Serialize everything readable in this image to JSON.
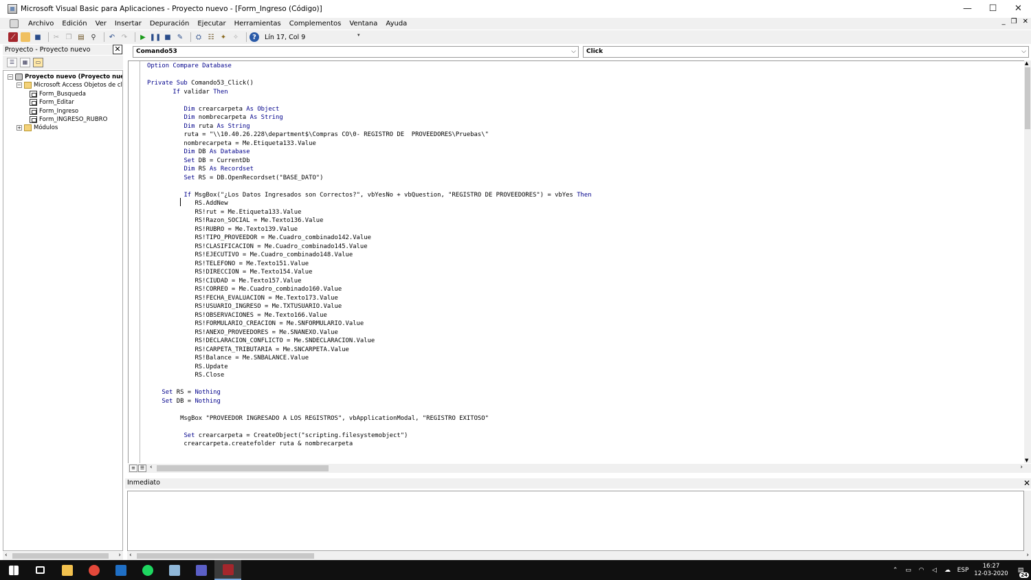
{
  "window": {
    "title": "Microsoft Visual Basic para Aplicaciones - Proyecto nuevo - [Form_Ingreso (Código)]",
    "minimize": "—",
    "maximize": "☐",
    "close": "✕"
  },
  "menubar": {
    "items": [
      "Archivo",
      "Edición",
      "Ver",
      "Insertar",
      "Depuración",
      "Ejecutar",
      "Herramientas",
      "Complementos",
      "Ventana",
      "Ayuda"
    ],
    "mdi_min": "_",
    "mdi_restore": "❐",
    "mdi_close": "✕"
  },
  "toolbar": {
    "position": "Lín 17, Col 9"
  },
  "project": {
    "title": "Proyecto - Proyecto nuevo",
    "close": "✕",
    "tree": [
      {
        "label": "Proyecto nuevo (Proyecto nuev",
        "level": 0,
        "icon": "proj",
        "expander": "−",
        "bold": true
      },
      {
        "label": "Microsoft Access Objetos de clas",
        "level": 1,
        "icon": "folder",
        "expander": "−",
        "bold": false
      },
      {
        "label": "Form_Busqueda",
        "level": 2,
        "icon": "form",
        "expander": "",
        "bold": false
      },
      {
        "label": "Form_Editar",
        "level": 2,
        "icon": "form",
        "expander": "",
        "bold": false
      },
      {
        "label": "Form_Ingreso",
        "level": 2,
        "icon": "form",
        "expander": "",
        "bold": false
      },
      {
        "label": "Form_INGRESO_RUBRO",
        "level": 2,
        "icon": "form",
        "expander": "",
        "bold": false
      },
      {
        "label": "Módulos",
        "level": 1,
        "icon": "folder",
        "expander": "+",
        "bold": false
      }
    ]
  },
  "code": {
    "object_dropdown": "Comando53",
    "procedure_dropdown": "Click",
    "lines": [
      "Option Compare Database",
      "",
      "Private Sub Comando53_Click()",
      "       If validar Then",
      "",
      "          Dim crearcarpeta As Object",
      "          Dim nombrecarpeta As String",
      "          Dim ruta As String",
      "          ruta = \"\\\\10.40.26.228\\department$\\Compras CO\\0- REGISTRO DE  PROVEEDORES\\Pruebas\\\"",
      "          nombrecarpeta = Me.Etiqueta133.Value",
      "          Dim DB As Database",
      "          Set DB = CurrentDb",
      "          Dim RS As Recordset",
      "          Set RS = DB.OpenRecordset(\"BASE_DATO\")",
      "",
      "          If MsgBox(\"¿Los Datos Ingresados son Correctos?\", vbYesNo + vbQuestion, \"REGISTRO DE PROVEEDORES\") = vbYes Then",
      "             RS.AddNew",
      "             RS!rut = Me.Etiqueta133.Value",
      "             RS!Razon_SOCIAL = Me.Texto136.Value",
      "             RS!RUBRO = Me.Texto139.Value",
      "             RS!TIPO_PROVEEDOR = Me.Cuadro_combinado142.Value",
      "             RS!CLASIFICACION = Me.Cuadro_combinado145.Value",
      "             RS!EJECUTIVO = Me.Cuadro_combinado148.Value",
      "             RS!TELEFONO = Me.Texto151.Value",
      "             RS!DIRECCION = Me.Texto154.Value",
      "             RS!CIUDAD = Me.Texto157.Value",
      "             RS!CORREO = Me.Cuadro_combinado160.Value",
      "             RS!FECHA_EVALUACION = Me.Texto173.Value",
      "             RS!USUARIO_INGRESO = Me.TXTUSUARIO.Value",
      "             RS!OBSERVACIONES = Me.Texto166.Value",
      "             RS!FORMULARIO_CREACION = Me.SNFORMULARIO.Value",
      "             RS!ANEXO_PROVEEDORES = Me.SNANEXO.Value",
      "             RS!DECLARACION_CONFLICTO = Me.SNDECLARACION.Value",
      "             RS!CARPETA_TRIBUTARIA = Me.SNCARPETA.Value",
      "             RS!Balance = Me.SNBALANCE.Value",
      "             RS.Update",
      "             RS.Close",
      "",
      "    Set RS = Nothing",
      "    Set DB = Nothing",
      "",
      "         MsgBox \"PROVEEDOR INGRESADO A LOS REGISTROS\", vbApplicationModal, \"REGISTRO EXITOSO\"",
      "",
      "          Set crearcarpeta = CreateObject(\"scripting.filesystemobject\")",
      "          crearcarpeta.createfolder ruta & nombrecarpeta"
    ]
  },
  "immediate": {
    "title": "Inmediato",
    "close": "✕"
  },
  "taskbar": {
    "apps": [
      {
        "name": "start",
        "color": "#ffffff"
      },
      {
        "name": "task-view",
        "color": "#ffffff"
      },
      {
        "name": "file-explorer",
        "color": "#f2c14e"
      },
      {
        "name": "chrome",
        "color": "#e4483a"
      },
      {
        "name": "outlook",
        "color": "#1f6fc5"
      },
      {
        "name": "spotify",
        "color": "#1ed760"
      },
      {
        "name": "notepad",
        "color": "#8fb7d8"
      },
      {
        "name": "teams",
        "color": "#5b5fc7"
      },
      {
        "name": "access",
        "color": "#a4262c"
      }
    ],
    "lang": "ESP",
    "time": "16:27",
    "date": "12-03-2020",
    "notifications": "24"
  }
}
